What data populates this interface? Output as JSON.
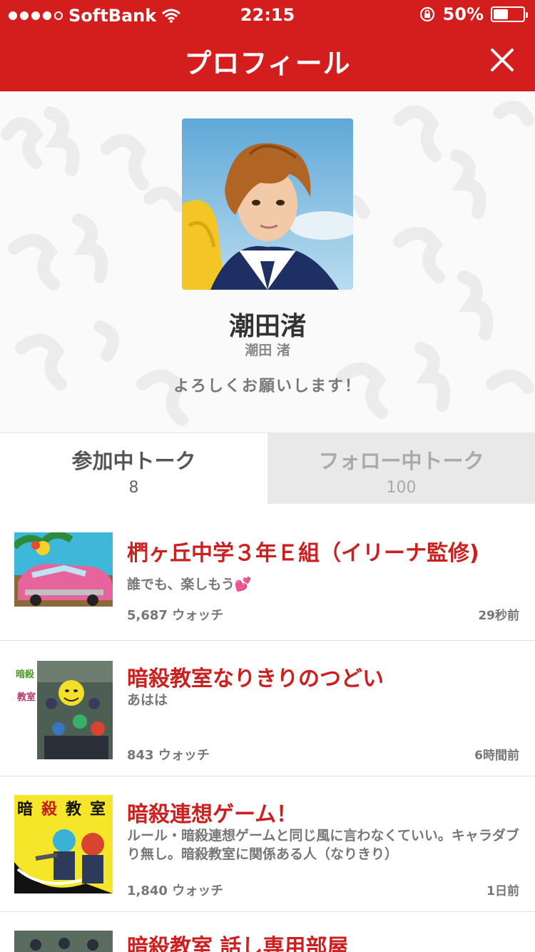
{
  "status_bar": {
    "carrier": "SoftBank",
    "time": "22:15",
    "battery": "50%",
    "battery_level": 0.5
  },
  "header": {
    "title": "プロフィール",
    "close_icon": "close-icon"
  },
  "profile": {
    "name": "潮田渚",
    "sub_name": "潮田 渚",
    "message": "よろしくお願いします！"
  },
  "tabs": [
    {
      "label": "参加中トーク",
      "count": "8"
    },
    {
      "label": "フォロー中トーク",
      "count": "100"
    }
  ],
  "talks": [
    {
      "title": "椚ヶ丘中学３年Ｅ組（イリーナ監修)",
      "description": "誰でも、楽しもう",
      "watch_count": "5,687",
      "watch_label": "ウォッチ",
      "time": "29秒前"
    },
    {
      "title": "暗殺教室なりきりのつどい",
      "description": "あはは",
      "thumb_label_1": "暗殺",
      "thumb_label_2": "教室",
      "watch_count": "843",
      "watch_label": "ウォッチ",
      "time": "6時間前"
    },
    {
      "title": "暗殺連想ゲーム！",
      "description": "ルール・暗殺連想ゲームと同じ風に言わなくていい。キャラダブり無し。暗殺教室に関係ある人（なりきり）",
      "thumb_label_1": "暗",
      "thumb_label_2": "殺",
      "thumb_label_3": "教",
      "thumb_label_4": "室",
      "watch_count": "1,840",
      "watch_label": "ウォッチ",
      "time": "1日前"
    },
    {
      "title": "暗殺教室 話し専用部屋"
    }
  ]
}
